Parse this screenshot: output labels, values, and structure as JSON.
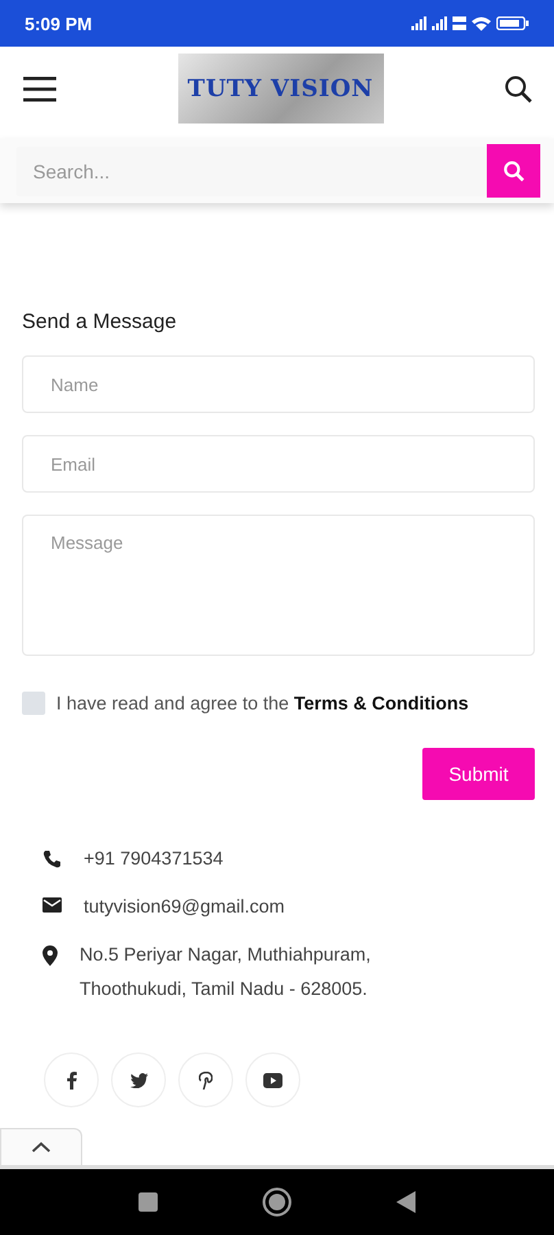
{
  "status_bar": {
    "time": "5:09 PM"
  },
  "header": {
    "logo": "TUTY VISION"
  },
  "search": {
    "placeholder": "Search..."
  },
  "form": {
    "title": "Send a Message",
    "fields": [
      {
        "kind": "input",
        "placeholder": "Name"
      },
      {
        "kind": "input",
        "placeholder": "Email"
      },
      {
        "kind": "textarea",
        "placeholder": "Message"
      }
    ],
    "agreement": {
      "text": "I have read and agree to the **Terms & Conditions**",
      "checked": false
    },
    "submit": "Submit"
  },
  "contacts": [
    {
      "kind": "phone",
      "text": "+91 7904371534"
    },
    {
      "kind": "email",
      "text": "tutyvision69@gmail.com"
    },
    {
      "kind": "location",
      "text": "No.5 Periyar Nagar, Muthiahpuram, Thoothukudi, Tamil Nadu - 628005."
    }
  ],
  "social": [
    {
      "kind": "facebook"
    },
    {
      "kind": "twitter"
    },
    {
      "kind": "pinterest"
    },
    {
      "kind": "youtube"
    }
  ]
}
